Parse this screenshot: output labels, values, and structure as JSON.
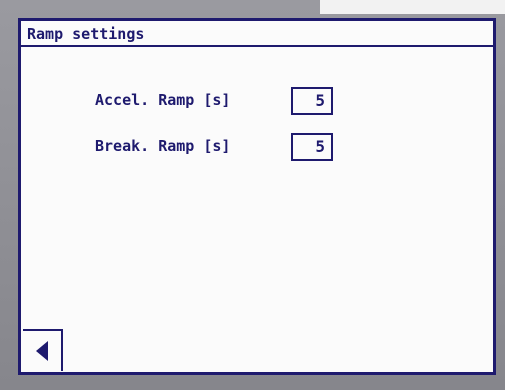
{
  "window": {
    "title": "Ramp settings"
  },
  "settings": [
    {
      "label": "Accel. Ramp [s]",
      "value": "5"
    },
    {
      "label": "Break. Ramp [s]",
      "value": "5"
    }
  ],
  "navigation": {
    "back_icon": "back-arrow-icon"
  },
  "colors": {
    "text": "#1e1a6e",
    "background": "#fbfbfb",
    "bezel": "#8e8e94"
  }
}
